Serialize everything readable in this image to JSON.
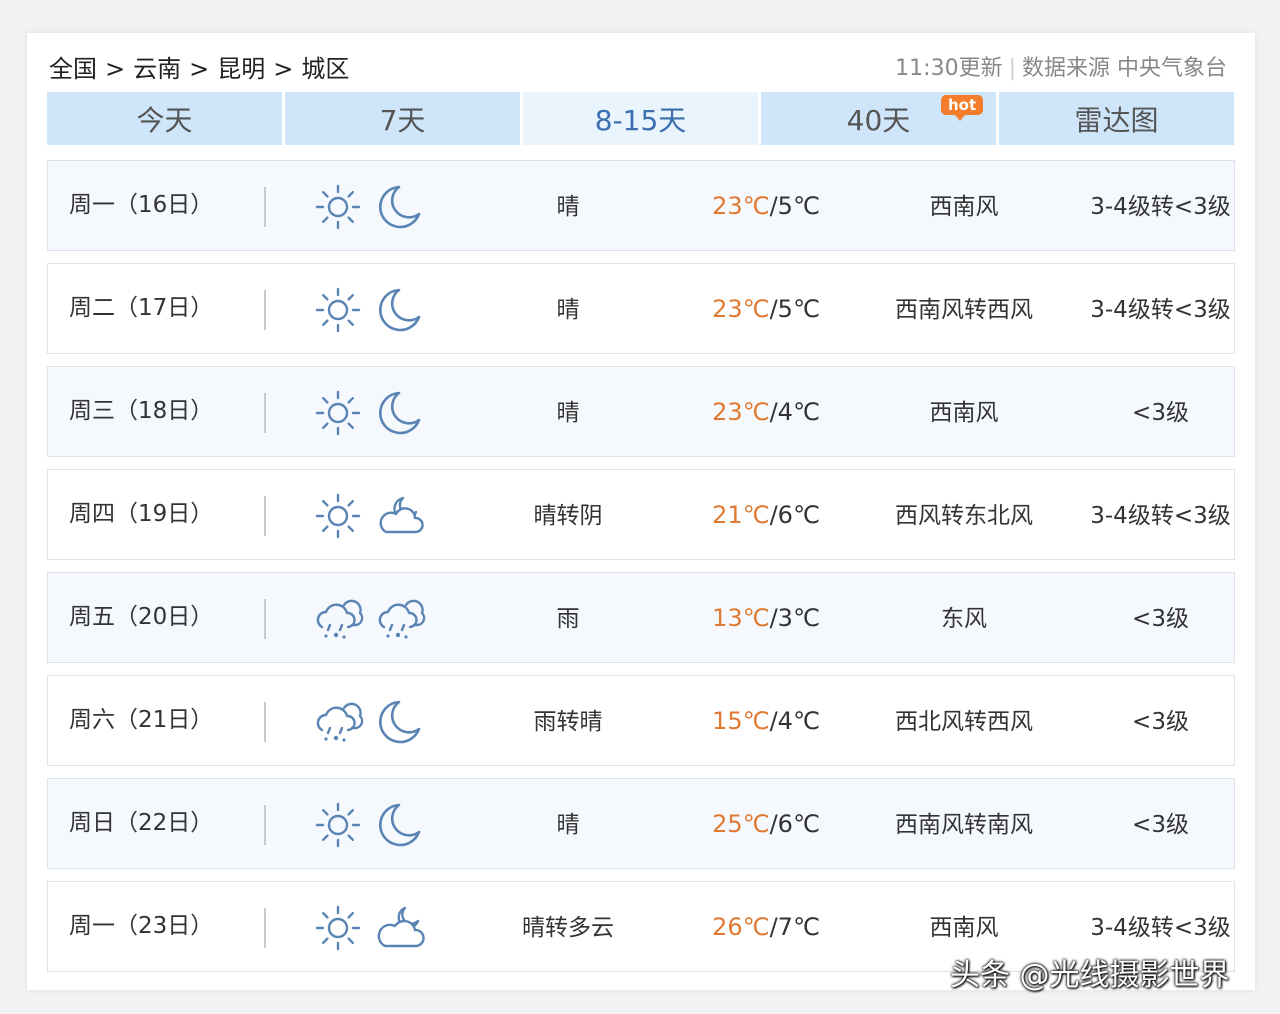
{
  "breadcrumb": {
    "items": [
      "全国",
      "云南",
      "昆明",
      "城区"
    ],
    "separator": ">"
  },
  "meta": {
    "update_time": "11:30更新",
    "divider": "|",
    "source": "数据来源 中央气象台"
  },
  "tabs": [
    {
      "label": "今天"
    },
    {
      "label": "7天"
    },
    {
      "label": "8-15天",
      "active": true
    },
    {
      "label": "40天",
      "badge": "hot"
    },
    {
      "label": "雷达图"
    }
  ],
  "forecast": [
    {
      "day": "周一（16日）",
      "icon_day": "sun-icon",
      "icon_night": "moon-icon",
      "condition": "晴",
      "high": "23℃",
      "low": "5℃",
      "wind": "西南风",
      "level": "3-4级转<3级"
    },
    {
      "day": "周二（17日）",
      "icon_day": "sun-icon",
      "icon_night": "moon-icon",
      "condition": "晴",
      "high": "23℃",
      "low": "5℃",
      "wind": "西南风转西风",
      "level": "3-4级转<3级"
    },
    {
      "day": "周三（18日）",
      "icon_day": "sun-icon",
      "icon_night": "moon-icon",
      "condition": "晴",
      "high": "23℃",
      "low": "4℃",
      "wind": "西南风",
      "level": "<3级"
    },
    {
      "day": "周四（19日）",
      "icon_day": "sun-icon",
      "icon_night": "cloudy-night-icon",
      "condition": "晴转阴",
      "high": "21℃",
      "low": "6℃",
      "wind": "西风转东北风",
      "level": "3-4级转<3级"
    },
    {
      "day": "周五（20日）",
      "icon_day": "rain-icon",
      "icon_night": "rain-icon",
      "condition": "雨",
      "high": "13℃",
      "low": "3℃",
      "wind": "东风",
      "level": "<3级"
    },
    {
      "day": "周六（21日）",
      "icon_day": "rain-icon",
      "icon_night": "moon-icon",
      "condition": "雨转晴",
      "high": "15℃",
      "low": "4℃",
      "wind": "西北风转西风",
      "level": "<3级"
    },
    {
      "day": "周日（22日）",
      "icon_day": "sun-icon",
      "icon_night": "moon-icon",
      "condition": "晴",
      "high": "25℃",
      "low": "6℃",
      "wind": "西南风转南风",
      "level": "<3级"
    },
    {
      "day": "周一（23日）",
      "icon_day": "sun-icon",
      "icon_night": "partly-cloudy-night-icon",
      "condition": "晴转多云",
      "high": "26℃",
      "low": "7℃",
      "wind": "西南风",
      "level": "3-4级转<3级"
    }
  ],
  "temp_separator": "/",
  "watermark": "头条 @光线摄影世界",
  "colors": {
    "tab_bg": "#cfe6fa",
    "tab_active_bg": "#eaf4fc",
    "tab_active_text": "#3a6fb0",
    "high_temp": "#e07a33",
    "icon_stroke": "#5a84b4",
    "hot_badge": "#f57c2a"
  }
}
